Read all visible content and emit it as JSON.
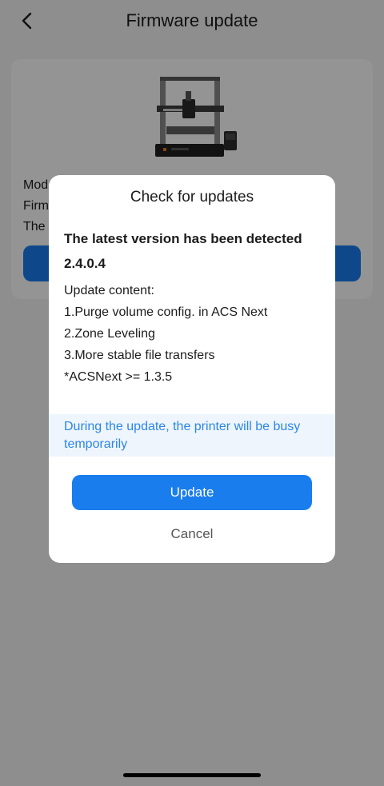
{
  "header": {
    "title": "Firmware update",
    "back_icon": "chevron-left-icon"
  },
  "device_card": {
    "image": "3d-printer-illustration",
    "info_lines": [
      "Mod",
      "Firm",
      "The"
    ]
  },
  "dialog": {
    "title": "Check for updates",
    "detected_text": "The latest version has been detected",
    "version": "2.4.0.4",
    "content_lines": [
      "Update content:",
      "1.Purge volume config. in ACS Next",
      "2.Zone Leveling",
      "3.More stable file transfers",
      "*ACSNext >= 1.3.5"
    ],
    "notice": "During the update, the printer will be busy temporarily",
    "update_label": "Update",
    "cancel_label": "Cancel"
  },
  "colors": {
    "accent": "#1a7dee",
    "notice_text": "#2c86e6",
    "notice_bg": "#eef5fd",
    "overlay": "rgba(0,0,0,0.42)"
  }
}
